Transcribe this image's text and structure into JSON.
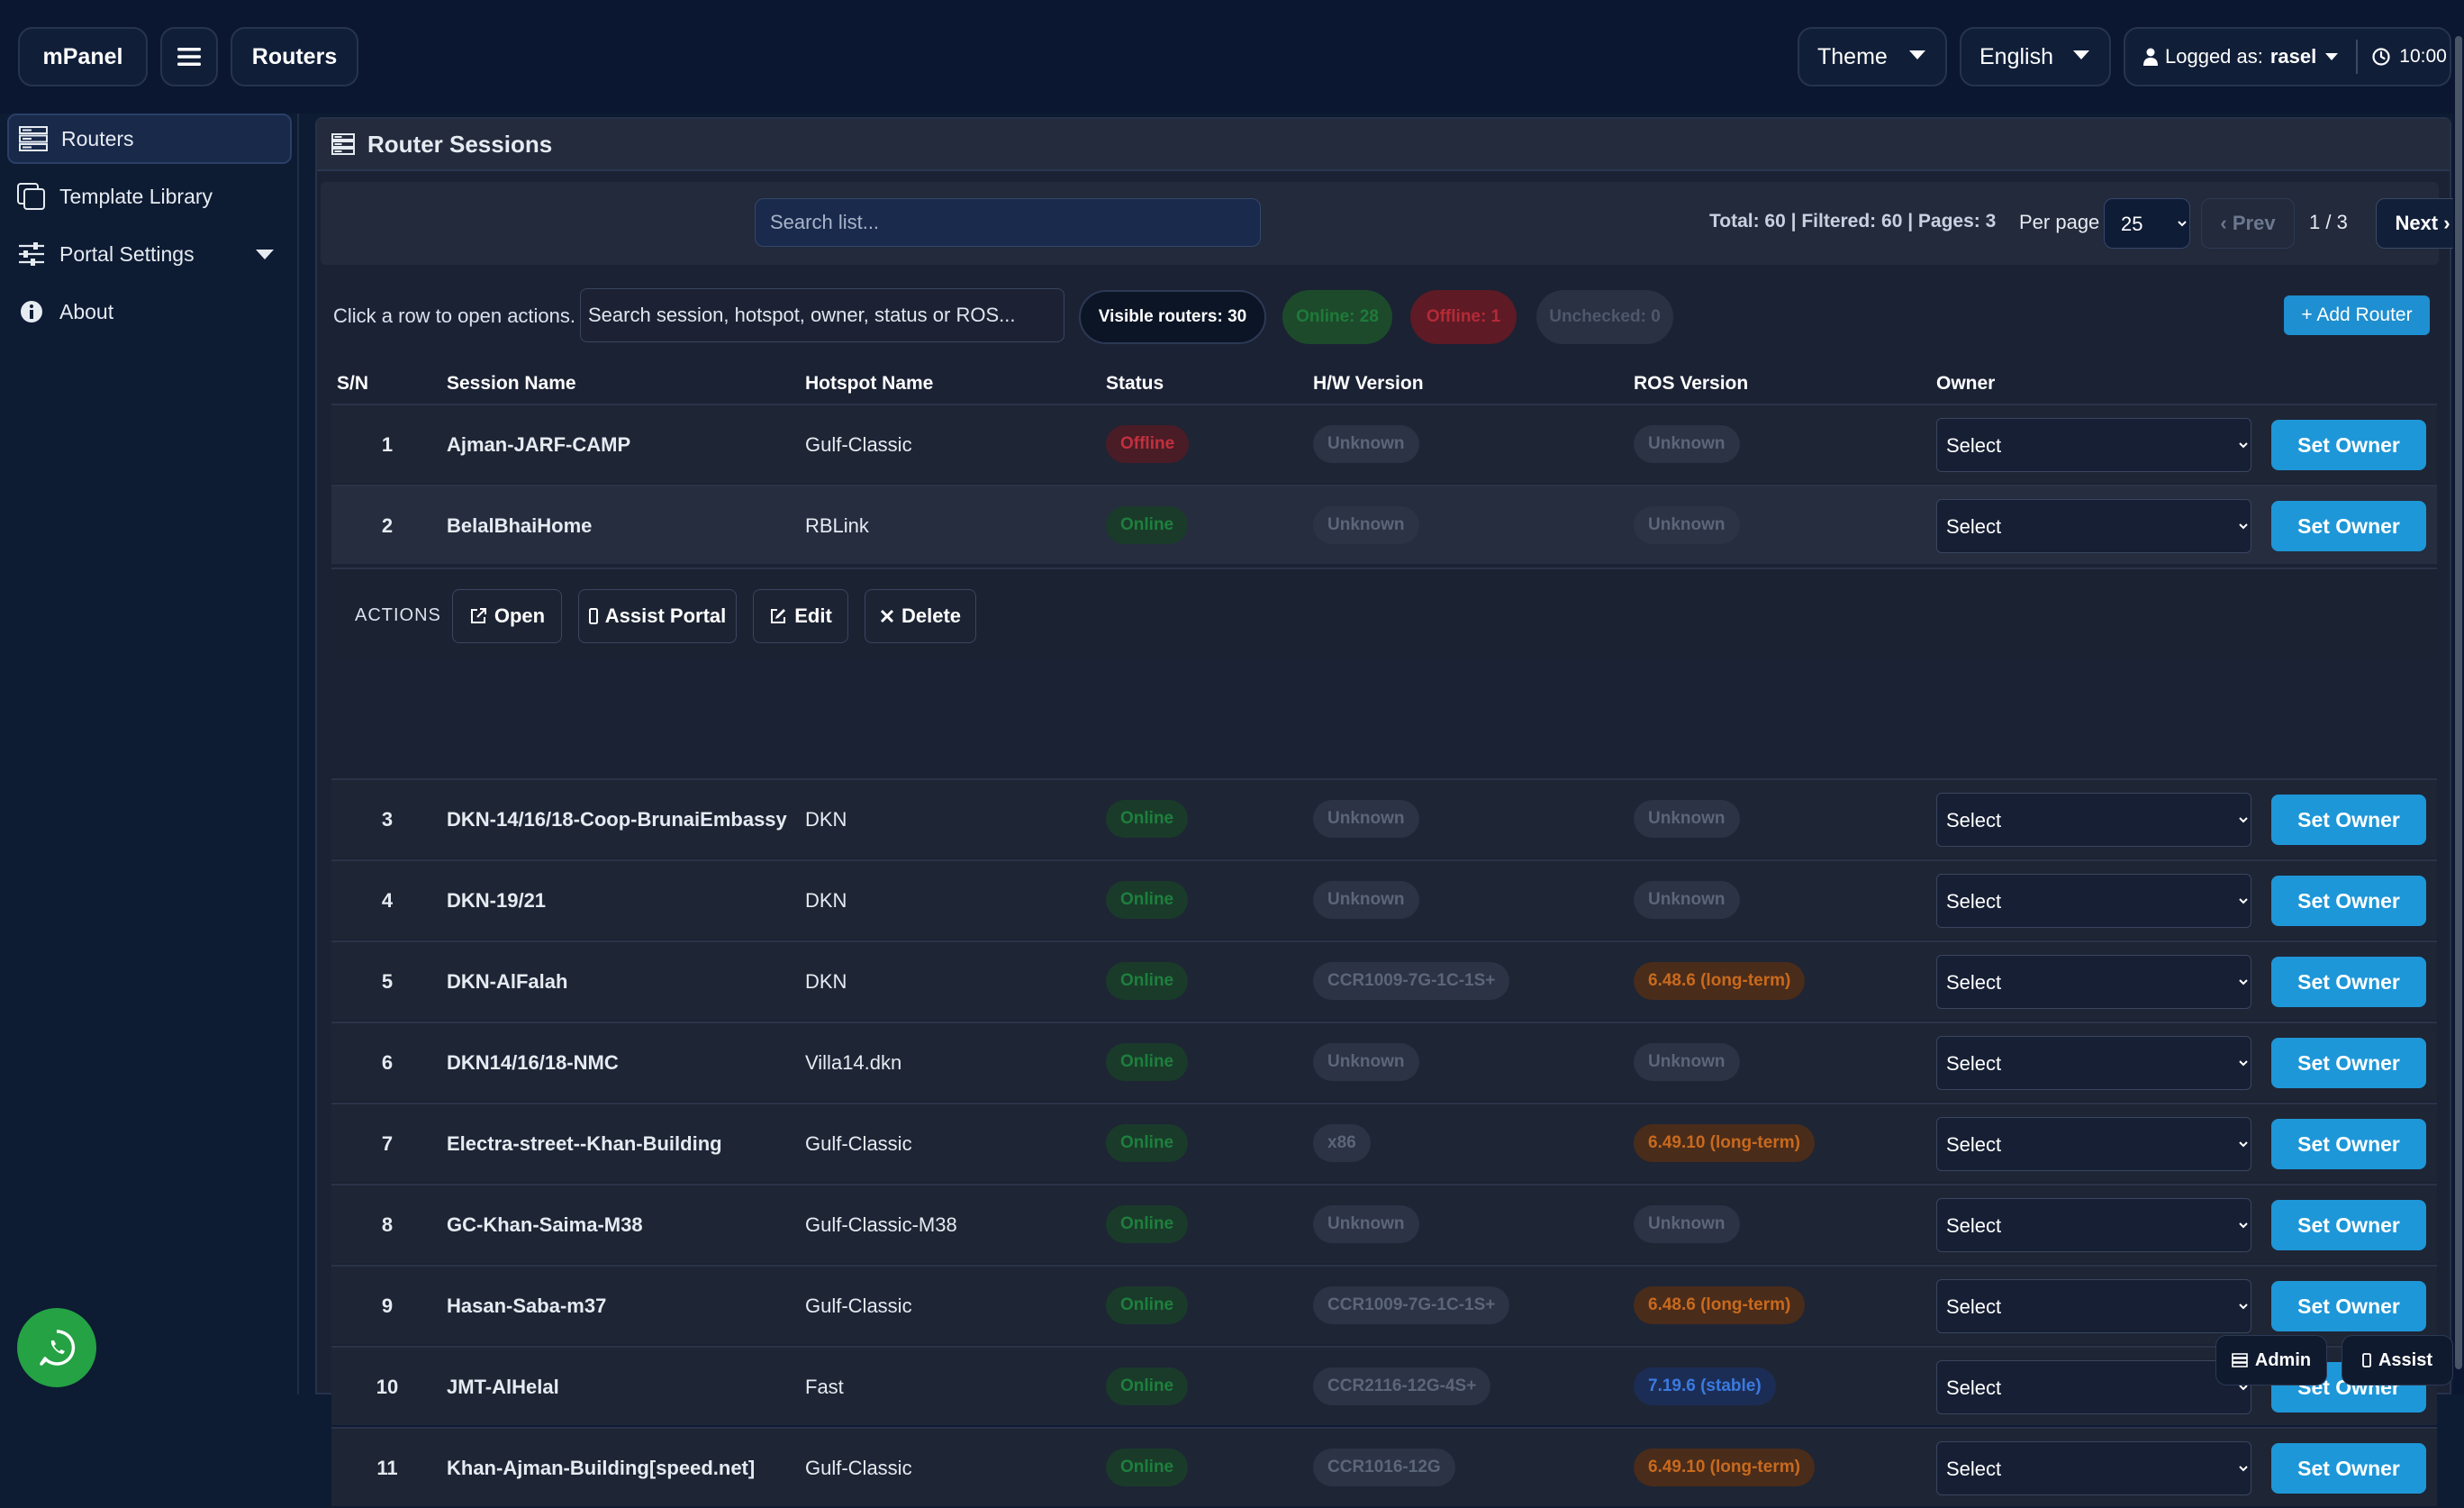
{
  "topbar": {
    "brand": "mPanel",
    "current": "Routers",
    "theme": "Theme",
    "language": "English",
    "logged_as_label": "Logged as:",
    "user": "rasel",
    "time": "10:00"
  },
  "sidebar": {
    "items": [
      {
        "label": "Routers",
        "icon": "server-icon"
      },
      {
        "label": "Template Library",
        "icon": "copy-icon"
      },
      {
        "label": "Portal Settings",
        "icon": "sliders-icon"
      },
      {
        "label": "About",
        "icon": "info-icon"
      }
    ]
  },
  "panel": {
    "title": "Router Sessions",
    "search_placeholder": "Search list...",
    "totals": "Total: 60 | Filtered: 60 | Pages: 3",
    "per_page_label": "Per page",
    "per_page_value": "25",
    "prev": "‹ Prev",
    "page": "1 / 3",
    "next": "Next ›",
    "hint": "Click a row to open actions.",
    "session_search_placeholder": "Search session, hotspot, owner, status or ROS...",
    "pills": {
      "visible": "Visible routers:",
      "visible_count": "30",
      "online": "Online: 28",
      "offline": "Offline: 1",
      "unchecked": "Unchecked: 0"
    },
    "add_router": "+ Add Router"
  },
  "table": {
    "headers": [
      "S/N",
      "Session Name",
      "Hotspot Name",
      "Status",
      "H/W Version",
      "ROS Version",
      "Owner"
    ],
    "owner_select": "Select",
    "set_owner": "Set Owner",
    "rows": [
      {
        "sn": "1",
        "session": "Ajman-JARF-CAMP",
        "hotspot": "Gulf-Classic",
        "status": "Offline",
        "hw": "Unknown",
        "ros": "Unknown",
        "ros_type": "unknown"
      },
      {
        "sn": "2",
        "session": "BelalBhaiHome",
        "hotspot": "RBLink",
        "status": "Online",
        "hw": "Unknown",
        "ros": "Unknown",
        "ros_type": "unknown"
      },
      {
        "sn": "3",
        "session": "DKN-14/16/18-Coop-BrunaiEmbassy",
        "hotspot": "DKN",
        "status": "Online",
        "hw": "Unknown",
        "ros": "Unknown",
        "ros_type": "unknown"
      },
      {
        "sn": "4",
        "session": "DKN-19/21",
        "hotspot": "DKN",
        "status": "Online",
        "hw": "Unknown",
        "ros": "Unknown",
        "ros_type": "unknown"
      },
      {
        "sn": "5",
        "session": "DKN-AlFalah",
        "hotspot": "DKN",
        "status": "Online",
        "hw": "CCR1009-7G-1C-1S+",
        "ros": "6.48.6 (long-term)",
        "ros_type": "lt"
      },
      {
        "sn": "6",
        "session": "DKN14/16/18-NMC",
        "hotspot": "Villa14.dkn",
        "status": "Online",
        "hw": "Unknown",
        "ros": "Unknown",
        "ros_type": "unknown"
      },
      {
        "sn": "7",
        "session": "Electra-street--Khan-Building",
        "hotspot": "Gulf-Classic",
        "status": "Online",
        "hw": "x86",
        "ros": "6.49.10 (long-term)",
        "ros_type": "lt"
      },
      {
        "sn": "8",
        "session": "GC-Khan-Saima-M38",
        "hotspot": "Gulf-Classic-M38",
        "status": "Online",
        "hw": "Unknown",
        "ros": "Unknown",
        "ros_type": "unknown"
      },
      {
        "sn": "9",
        "session": "Hasan-Saba-m37",
        "hotspot": "Gulf-Classic",
        "status": "Online",
        "hw": "CCR1009-7G-1C-1S+",
        "ros": "6.48.6 (long-term)",
        "ros_type": "lt"
      },
      {
        "sn": "10",
        "session": "JMT-AlHelal",
        "hotspot": "Fast",
        "status": "Online",
        "hw": "CCR2116-12G-4S+",
        "ros": "7.19.6 (stable)",
        "ros_type": "stable"
      },
      {
        "sn": "11",
        "session": "Khan-Ajman-Building[speed.net]",
        "hotspot": "Gulf-Classic",
        "status": "Online",
        "hw": "CCR1016-12G",
        "ros": "6.49.10 (long-term)",
        "ros_type": "lt"
      }
    ]
  },
  "actions": {
    "label": "ACTIONS",
    "open": "Open",
    "assist_portal": "Assist Portal",
    "edit": "Edit",
    "delete": "Delete"
  },
  "floating": {
    "admin": "Admin",
    "assist": "Assist"
  },
  "colors": {
    "accent": "#1e97d8",
    "online": "#1e7f3d",
    "offline": "#c2303d",
    "long_term": "#c86a1e",
    "stable": "#3a7ae0",
    "whatsapp": "#25a244"
  }
}
